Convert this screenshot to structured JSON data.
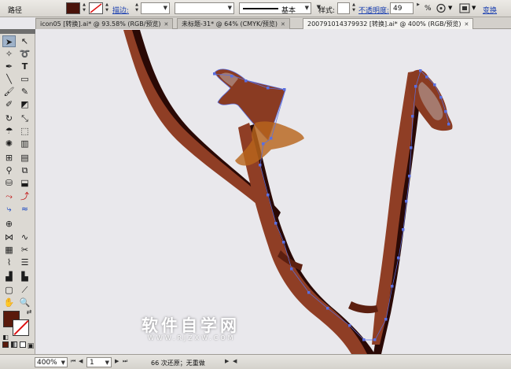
{
  "control_bar": {
    "object_type": "路径",
    "fill_color": "#4a130a",
    "stroke_label": "描边:",
    "stroke_weight": "",
    "brush_label": "基本",
    "style_label": "样式:",
    "opacity_label": "不透明度:",
    "opacity_value": "49",
    "opacity_unit": "%",
    "transform_label": "变换"
  },
  "tabs": [
    {
      "label": "icon05 [转换].ai* @ 93.58% (RGB/预览)",
      "active": false
    },
    {
      "label": "未标题-31* @ 64% (CMYK/预览)",
      "active": false
    },
    {
      "label": "20079101437993​2 [转换].ai* @ 400% (RGB/预览)",
      "active": true
    }
  ],
  "tools": {
    "fill_color": "#5a1a0c",
    "icons": [
      "selection-arrow-icon",
      "direct-selection-icon",
      "magic-wand-icon",
      "lasso-icon",
      "pen-icon",
      "type-icon",
      "line-icon",
      "rectangle-icon",
      "paintbrush-icon",
      "pencil-icon",
      "blob-brush-icon",
      "eraser-icon",
      "rotate-icon",
      "scale-icon",
      "warp-icon",
      "free-transform-icon",
      "symbol-sprayer-icon",
      "column-graph-icon",
      "mesh-icon",
      "gradient-icon",
      "eyedropper-icon",
      "blend-icon",
      "live-paint-icon",
      "live-paint-select-icon",
      "crop-icon",
      "slice-icon",
      "hand-icon",
      "zoom-icon"
    ]
  },
  "status_bar": {
    "zoom": "400%",
    "artboard": "1",
    "status_text": "66 次还原；无重做"
  },
  "watermark": {
    "main": "软件自学网",
    "sub": "WWW.RJZXW.COM"
  },
  "colors": {
    "branch_fill": "#8f3e25",
    "branch_dark": "#2a0905",
    "leaf_orange": "#b8651c",
    "leaf_muted": "#a57a6e",
    "anchor": "#5a6fe0"
  }
}
